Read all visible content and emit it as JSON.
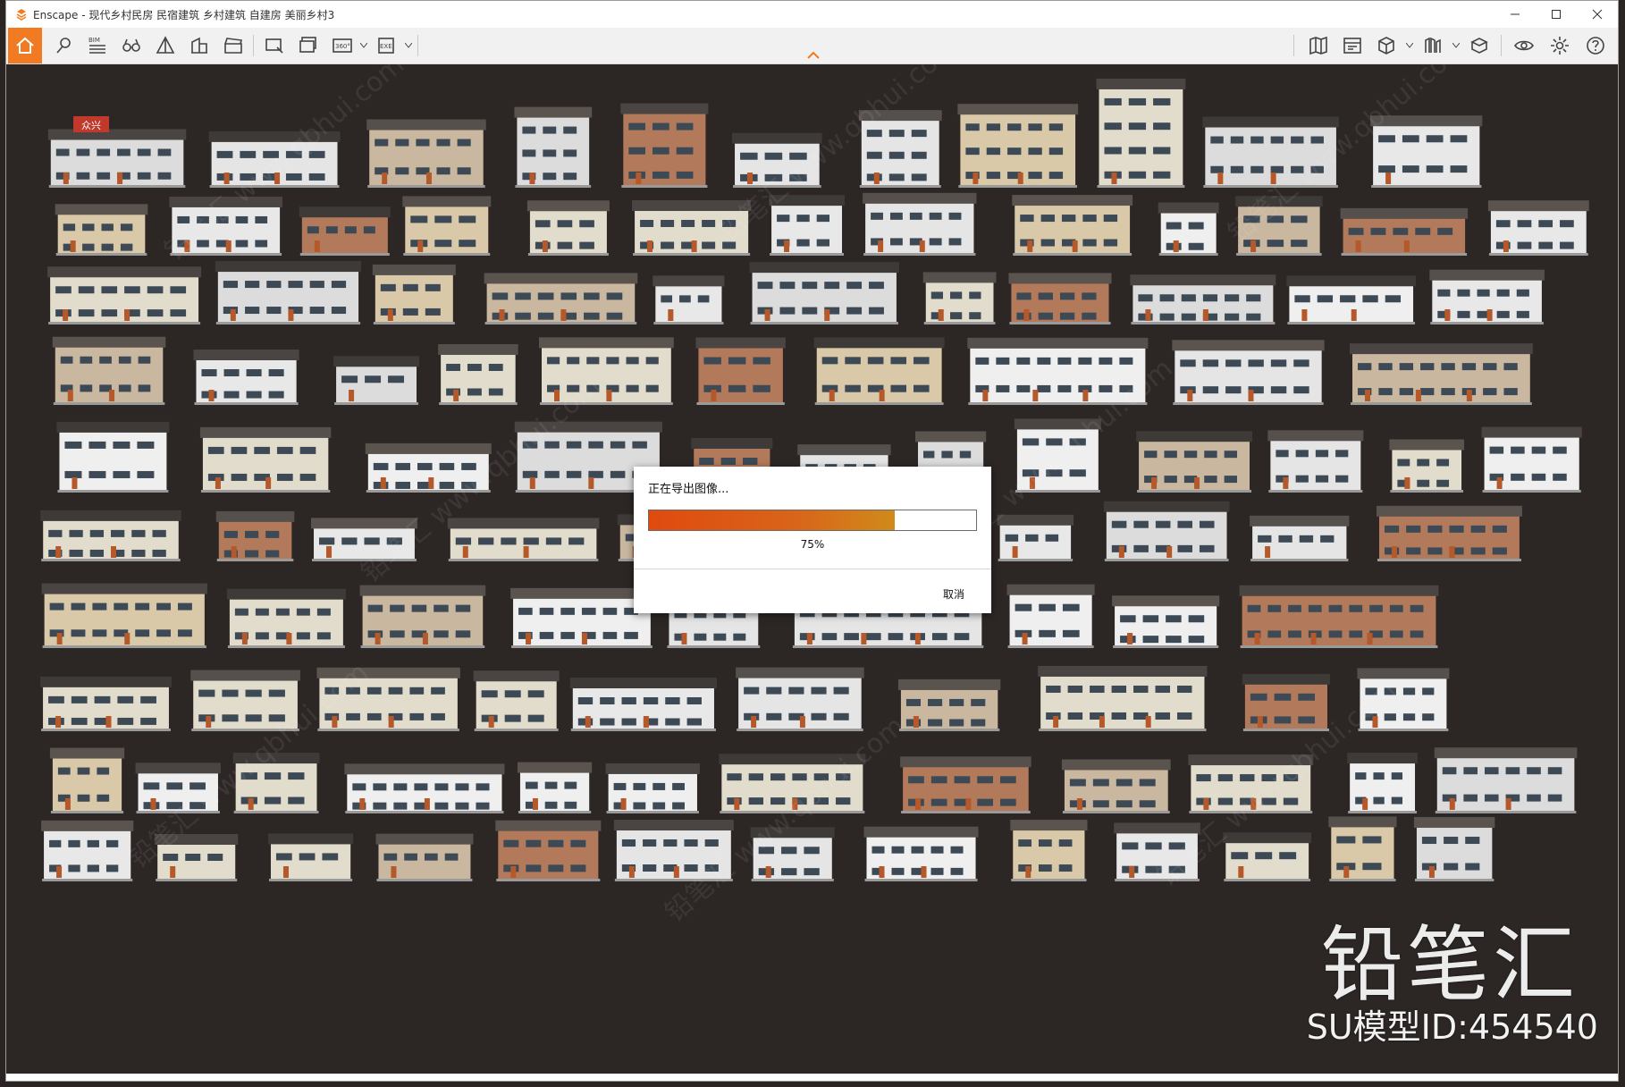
{
  "window": {
    "title": "Enscape - 现代乡村民房 民宿建筑 乡村建筑 自建房 美丽乡村3",
    "accent": "#f07b22"
  },
  "toolbar": {
    "left_icons": [
      "home-icon",
      "pin-icon",
      "bim-icon",
      "binoculars-icon",
      "tent-icon",
      "building-icon",
      "clapper-icon",
      "screenshot-icon",
      "batch-render-icon",
      "panorama-360-icon",
      "export-exe-icon"
    ],
    "bim_label": "BIM",
    "pano_label": "360°",
    "exe_label": "EXE",
    "right_icons": [
      "map-icon",
      "video-editor-icon",
      "asset-cube-icon",
      "library-icon",
      "material-icon",
      "view-eye-icon",
      "settings-gear-icon",
      "help-icon"
    ]
  },
  "dialog": {
    "title": "正在导出图像...",
    "progress": 0.75,
    "progress_label": "75%",
    "cancel": "取消"
  },
  "scene": {
    "sign_text": "众兴"
  },
  "watermark": {
    "brand": "铅笔汇",
    "model_id": "SU模型ID:454540",
    "diagonal": "铅笔汇 www.qbhui.com"
  }
}
